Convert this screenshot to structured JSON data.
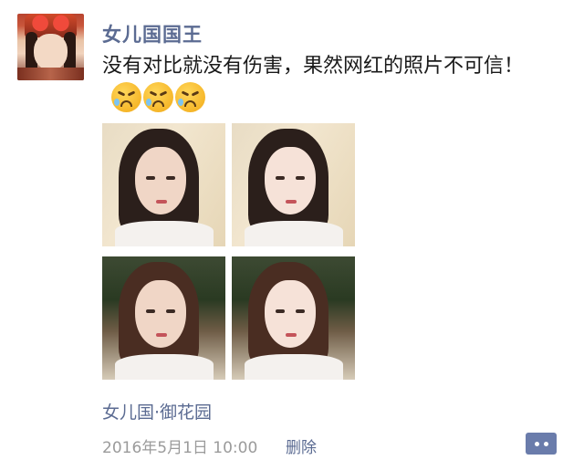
{
  "post": {
    "username": "女儿国国王",
    "text": "没有对比就没有伤害，果然网红的照片不可信！",
    "emojis": [
      "tears-of-frustration-emoji",
      "tears-of-frustration-emoji",
      "tears-of-frustration-emoji"
    ],
    "location": "女儿国·御花园",
    "timestamp": "2016年5月1日 10:00",
    "delete_label": "删除"
  },
  "photos": [
    {
      "name": "photo-original-1"
    },
    {
      "name": "photo-edited-1"
    },
    {
      "name": "photo-original-2"
    },
    {
      "name": "photo-edited-2"
    }
  ],
  "colors": {
    "link": "#5b6b92",
    "meta": "#9b9b9b",
    "more_button": "#6a7cab"
  },
  "icons": {
    "more": "comment-more-icon"
  }
}
